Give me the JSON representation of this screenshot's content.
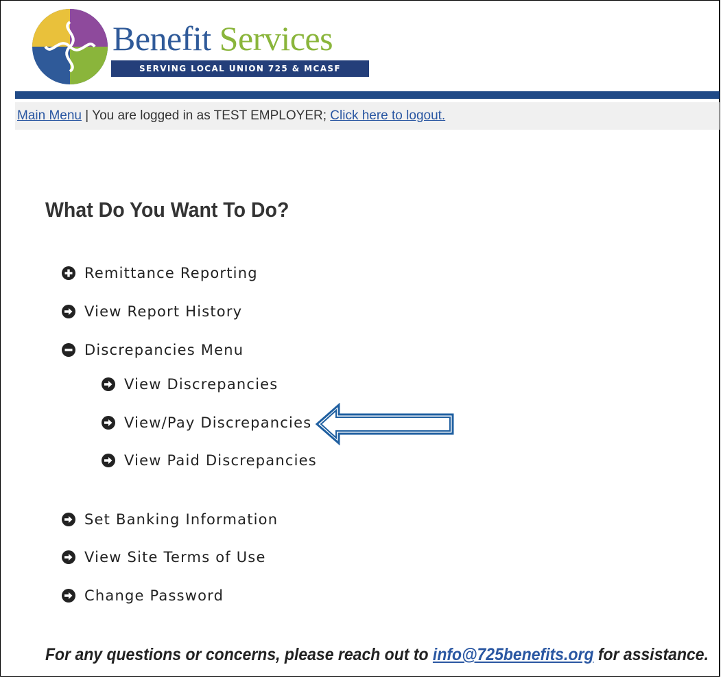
{
  "brand": {
    "name_part1": "Benefit",
    "name_part2": "Services",
    "tagline": "SERVING LOCAL UNION 725 & MCASF",
    "colors": {
      "primary": "#204a87",
      "green": "#8ab53b",
      "purple": "#8e4a9c",
      "yellow": "#e9c13b",
      "blue": "#2f5a99"
    }
  },
  "nav": {
    "main_menu": "Main Menu",
    "separator": " | You are logged in as TEST EMPLOYER; ",
    "logout": "Click here to logout."
  },
  "page_title": "What Do You Want To Do?",
  "menu": {
    "remittance": {
      "label": "Remittance Reporting",
      "icon": "plus-circle-icon"
    },
    "report_history": {
      "label": "View Report History",
      "icon": "arrow-right-circle-icon"
    },
    "discrepancies": {
      "label": "Discrepancies Menu",
      "icon": "minus-circle-icon"
    },
    "view_discrepancies": {
      "label": "View Discrepancies",
      "icon": "arrow-right-circle-icon"
    },
    "view_pay_discrepancies": {
      "label": "View/Pay Discrepancies",
      "icon": "arrow-right-circle-icon"
    },
    "view_paid_discrepancies": {
      "label": "View Paid Discrepancies",
      "icon": "arrow-right-circle-icon"
    },
    "banking": {
      "label": "Set Banking Information",
      "icon": "arrow-right-circle-icon"
    },
    "terms": {
      "label": "View Site Terms of Use",
      "icon": "arrow-right-circle-icon"
    },
    "password": {
      "label": "Change Password",
      "icon": "arrow-right-circle-icon"
    }
  },
  "footer": {
    "before": "For any questions or concerns, please reach out to ",
    "email": "info@725benefits.org",
    "after": " for assistance."
  },
  "annotation": {
    "icon": "callout-arrow-left-icon",
    "color": "#1f5fa0"
  }
}
